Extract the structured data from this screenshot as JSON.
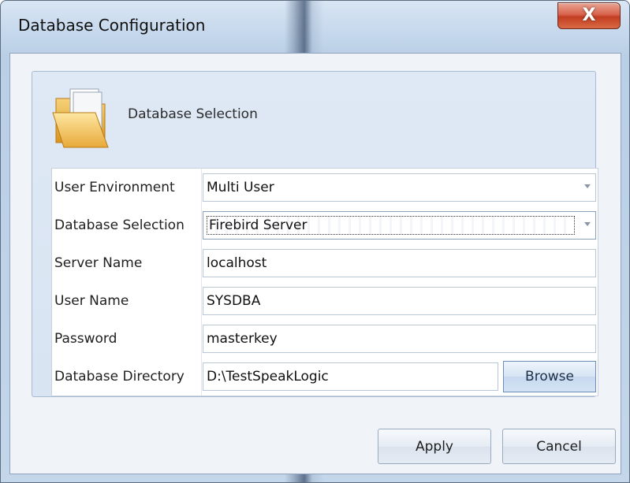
{
  "window": {
    "title": "Database Configuration",
    "close_label": "X"
  },
  "header": {
    "title": "Database Selection",
    "icon": "folder-icon"
  },
  "form": {
    "rows": [
      {
        "label": "User Environment",
        "value": "Multi User",
        "type": "dropdown"
      },
      {
        "label": "Database Selection",
        "value": "Firebird Server",
        "type": "dropdown"
      },
      {
        "label": "Server Name",
        "value": "localhost",
        "type": "text"
      },
      {
        "label": "User Name",
        "value": "SYSDBA",
        "type": "text"
      },
      {
        "label": "Password",
        "value": "masterkey",
        "type": "text"
      },
      {
        "label": "Database Directory",
        "value": "D:\\TestSpeakLogic",
        "type": "text"
      }
    ],
    "browse_label": "Browse"
  },
  "buttons": {
    "apply": "Apply",
    "cancel": "Cancel"
  },
  "colors": {
    "close_button": "#c94a30",
    "panel_background": "#dfe9f5",
    "client_background": "#f0f4f9"
  }
}
